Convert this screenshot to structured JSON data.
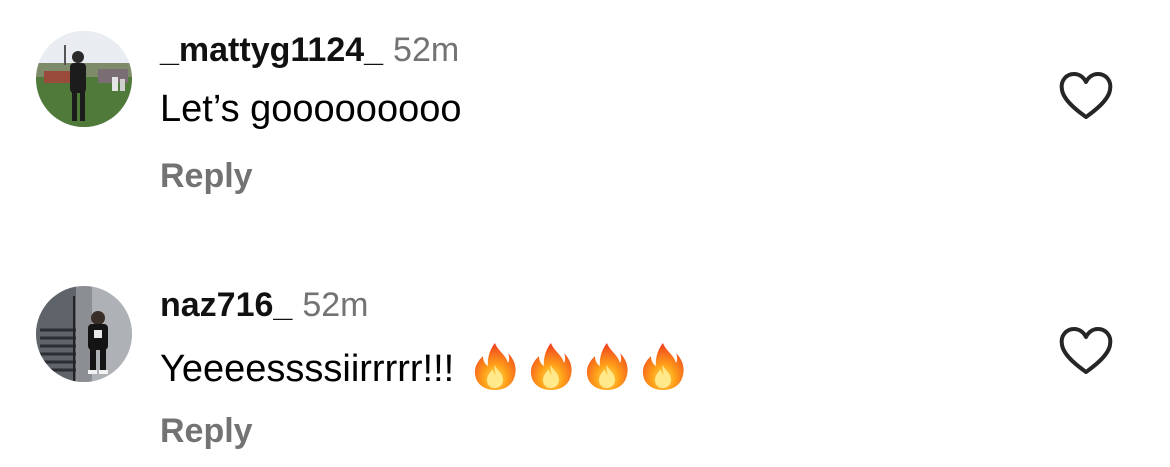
{
  "comments": [
    {
      "username": "_mattyg1124_",
      "timestamp": "52m",
      "text": "Let’s gooooooooo",
      "emojis": [],
      "reply_label": "Reply",
      "like_icon": "heart-outline-icon",
      "avatar": "football-field-photo"
    },
    {
      "username": "naz716_",
      "timestamp": "52m",
      "text": "Yeeeessssiirrrrr!!!",
      "emojis": [
        "fire-icon",
        "fire-icon",
        "fire-icon",
        "fire-icon"
      ],
      "reply_label": "Reply",
      "like_icon": "heart-outline-icon",
      "avatar": "stairway-selfie-photo"
    }
  ],
  "colors": {
    "username": "#111111",
    "secondary_text": "#737373",
    "body_text": "#000000",
    "heart_stroke": "#262626"
  }
}
